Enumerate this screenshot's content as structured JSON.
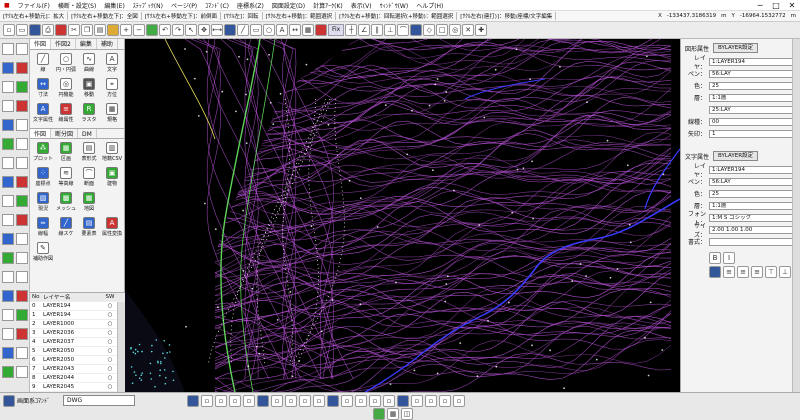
{
  "menu": [
    "ファイル(F)",
    "横断・設定(S)",
    "編集(E)",
    "ｽﾃｯﾌﾟｯｸ(N)",
    "ページ(P)",
    "ｺﾏﾝﾄﾞ(C)",
    "座標系(Z)",
    "図面設定(D)",
    "計算ｱｰｸ(K)",
    "表示(V)",
    "ｳｨﾝﾄﾞｳ(W)",
    "ヘルプ(H)"
  ],
  "modes": [
    "[ｻｸﾙ左右+移動元]：拡大",
    "[ｻｸﾙ左右+移動左下]：全図",
    "[ｻｸﾙ左右+移動左下]：前倒面",
    "[ｻｸﾙ左]：回転",
    "[ｻｸﾙ左右+移動]：範囲選択",
    "[ｻｸﾙ左右+移動]：回転選択(+移動)：範囲選択",
    "[ｻｸﾙ左右(連打)]：移動/座標/文字編集"
  ],
  "coords": {
    "x_label": "X",
    "x_value": "-133437.3186319",
    "x_unit": "m",
    "y_label": "Y",
    "y_value": "-16964.1532772",
    "y_unit": "m"
  },
  "toolbar": {
    "text_btn": "Fix"
  },
  "palette": {
    "tabs": [
      "作図",
      "作図2",
      "編集",
      "補助"
    ],
    "tabs2": [
      "作図",
      "断分図",
      "DM"
    ],
    "row1": [
      "線",
      "円・円弧",
      "曲線",
      "文字"
    ],
    "row2": [
      "寸法",
      "円機能",
      "移動",
      "方位"
    ],
    "row3": [
      "文字属性",
      "線属性",
      "ラスタ",
      "規格"
    ],
    "row4": [
      "プロット",
      "区画",
      "表形式",
      "地籍CSV"
    ],
    "row5": [
      "座標点",
      "等高線",
      "断面",
      "建物"
    ],
    "row6": [
      "現況",
      "メッシュ",
      "地図",
      ""
    ],
    "row7": [
      "線幅",
      "線スケ",
      "要素表",
      "属性変換"
    ],
    "row8": [
      "補助作図"
    ]
  },
  "layers": {
    "headers": [
      "No",
      "レイヤー名",
      "SW"
    ],
    "rows": [
      [
        "0",
        "LAYER194"
      ],
      [
        "1",
        "LAYER194"
      ],
      [
        "2",
        "LAYER1000"
      ],
      [
        "3",
        "LAYER2036"
      ],
      [
        "4",
        "LAYER2037"
      ],
      [
        "5",
        "LAYER2050"
      ],
      [
        "6",
        "LAYER2050"
      ],
      [
        "7",
        "LAYER2043"
      ],
      [
        "8",
        "LAYER2044"
      ],
      [
        "9",
        "LAYER2045"
      ]
    ]
  },
  "fig_props": {
    "title": "図形属性",
    "btn": "BYLAYER設定",
    "rows": [
      [
        "レイヤ：",
        "1:LAYER194"
      ],
      [
        "ペン：",
        "56:LAY"
      ],
      [
        "色：",
        "25"
      ],
      [
        "層：",
        "1:1層"
      ],
      [
        "",
        "25:LAY"
      ],
      [
        "線種：",
        "00"
      ],
      [
        "矢印：",
        "1"
      ]
    ],
    "line_type_text": "BYLAYER"
  },
  "text_props": {
    "title": "文字属性",
    "btn": "BYLAYER設定",
    "rows": [
      [
        "レイヤ：",
        "1:LAYER194"
      ],
      [
        "ペン：",
        "56:LAY"
      ],
      [
        "色：",
        "25"
      ],
      [
        "層：",
        "1:1層"
      ],
      [
        "フォント：",
        "1:M S ゴシック"
      ],
      [
        "サイズ：",
        "2.00 1.00 1.00"
      ],
      [
        "書式：",
        ""
      ]
    ]
  },
  "bottom": {
    "cmd": "画面系ｺﾏﾝﾄﾞ",
    "combo": "DWG"
  },
  "colors": {
    "magenta": "#b44fd3",
    "blue": "#3a3aff",
    "green": "#5fd35a",
    "white": "#ffffff",
    "yellow": "#e8e05a"
  }
}
